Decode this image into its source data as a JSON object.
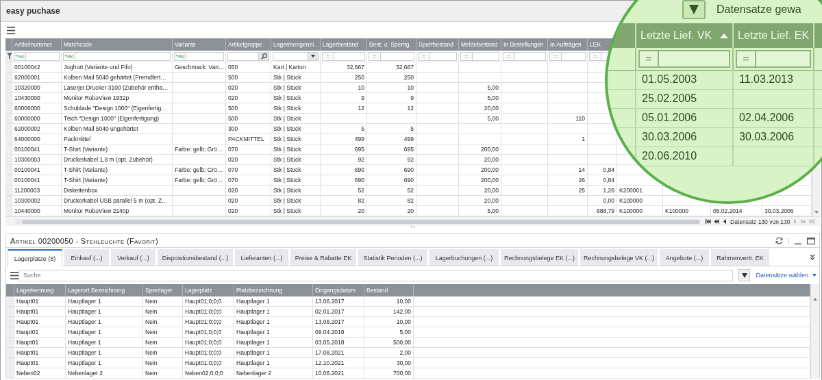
{
  "window": {
    "title": "easy puchase"
  },
  "main_table": {
    "columns": [
      {
        "label": "Artikelnummer",
        "kind": "text"
      },
      {
        "label": "Matchcode",
        "kind": "text"
      },
      {
        "label": "Variante",
        "kind": "text"
      },
      {
        "label": "Artikelgruppe",
        "kind": "text"
      },
      {
        "label": "Lagermengenei…",
        "kind": "text"
      },
      {
        "label": "Lagerbestand",
        "kind": "number"
      },
      {
        "label": "Best. o. Sperrig.",
        "kind": "number"
      },
      {
        "label": "Sperrbestand",
        "kind": "number"
      },
      {
        "label": "Meldebestand",
        "kind": "number"
      },
      {
        "label": "In Bestellungen",
        "kind": "number"
      },
      {
        "label": "In Aufträgen",
        "kind": "number"
      },
      {
        "label": "LEK",
        "kind": "number"
      },
      {
        "kind": "text"
      },
      {
        "kind": "text"
      },
      {
        "kind": "text"
      },
      {
        "kind": "text"
      }
    ],
    "filters": [
      {
        "kind": "pattern",
        "operator": "*%c"
      },
      {
        "kind": "pattern",
        "operator": "*%c"
      },
      {
        "kind": "pattern",
        "operator": "*%c"
      },
      {
        "kind": "search"
      },
      {
        "kind": "dropdown"
      },
      {
        "kind": "equals",
        "operator": "="
      },
      {
        "kind": "equals",
        "operator": "="
      },
      {
        "kind": "equals",
        "operator": "="
      },
      {
        "kind": "equals",
        "operator": "="
      },
      {
        "kind": "equals",
        "operator": "="
      },
      {
        "kind": "equals",
        "operator": "="
      },
      {
        "kind": "equals",
        "operator": "="
      }
    ],
    "rows": [
      [
        "00100042",
        "Joghurt (Variante und Fifo)",
        "Geschmack: Van…",
        "050",
        "Kart  |  Karton",
        "32,667",
        "32,667"
      ],
      [
        "62000001",
        "Kolben Mail 5040 gehärtet (Fremdfert…",
        null,
        "500",
        "Stk  |  Stück",
        "250",
        "250"
      ],
      [
        "10320000",
        "Laserjet Drucker 3100 (Zubehör entha…",
        null,
        "020",
        "Stk  |  Stück",
        "10",
        "10",
        null,
        "5,00"
      ],
      [
        "10430000",
        "Monitor RoboView 1932p",
        null,
        "020",
        "Stk  |  Stück",
        "9",
        "9",
        null,
        "5,00"
      ],
      [
        "60006000",
        "Schublade \"Design 1000\" (Eigenfertig…",
        null,
        "500",
        "Stk  |  Stück",
        "12",
        "12",
        null,
        "20,00"
      ],
      [
        "60000000",
        "Tisch \"Design 1000\" (Eigenfertigung)",
        null,
        "500",
        "Stk  |  Stück",
        null,
        null,
        null,
        "5,00",
        null,
        "110"
      ],
      [
        "62000002",
        "Kolben Mail 5040 ungehärtet",
        null,
        "300",
        "Stk  |  Stück",
        "5",
        "5"
      ],
      [
        "64000000",
        "Packmittel",
        null,
        "PACKMITTEL",
        "Stk  |  Stück",
        "499",
        "499",
        null,
        null,
        null,
        "1"
      ],
      [
        "00100041",
        "T-Shirt (Variante)",
        "Farbe: gelb; Grö…",
        "070",
        "Stk  |  Stück",
        "695",
        "695",
        null,
        "200,00"
      ],
      [
        "10300003",
        "Druckerkabel 1,8 m (opt. Zubehör)",
        null,
        "020",
        "Stk  |  Stück",
        "92",
        "92",
        null,
        "20,00"
      ],
      [
        "00100041",
        "T-Shirt (Variante)",
        "Farbe: gelb; Grö…",
        "070",
        "Stk  |  Stück",
        "690",
        "690",
        null,
        "200,00",
        null,
        "14",
        "0,84"
      ],
      [
        "00100041",
        "T-Shirt (Variante)",
        "Farbe: gelb; Grö…",
        "070",
        "Stk  |  Stück",
        "690",
        "690",
        null,
        "200,00",
        null,
        "26",
        "0,84"
      ],
      [
        "11200003",
        "Diskettenbox",
        null,
        "020",
        "Stk  |  Stück",
        "52",
        "52",
        null,
        "20,00",
        null,
        "25",
        "1,26",
        "K200001"
      ],
      [
        "10300002",
        "Druckerkabel USB parallel 5 m (opt. Z…",
        null,
        "020",
        "Stk  |  Stück",
        "82",
        "82",
        null,
        "20,00",
        null,
        null,
        "0,00",
        "K100000"
      ],
      [
        "10440000",
        "Monitor RoboView 2140p",
        null,
        "020",
        "Stk  |  Stück",
        "20",
        "20",
        null,
        "5,00",
        null,
        null,
        "688,79",
        "K100000",
        "K100000",
        "05.02.2014",
        "30.03.2006"
      ]
    ],
    "pager": {
      "text": "Datensatz 130 von 130",
      "can_go_back": true,
      "can_go_forward": false
    }
  },
  "magnifier": {
    "toolbar_text": "Datensatze gewa",
    "columns": [
      {
        "label": "Letzte Lief. VK",
        "sorted_ascending": true
      },
      {
        "label": "Letzte Lief. EK",
        "sorted_ascending": false
      }
    ],
    "filters": [
      {
        "kind": "equals",
        "operator": "="
      },
      {
        "kind": "equals",
        "operator": "="
      }
    ],
    "rows": [
      [
        "01.05.2003",
        "11.03.2013"
      ],
      [
        "25.02.2005"
      ],
      [
        "05.01.2006",
        "02.04.2006"
      ],
      [
        "30.03.2006",
        "30.03.2006"
      ],
      [
        "20.06.2010"
      ]
    ]
  },
  "detail_panel": {
    "title": "Artikel 00200050 - Stehleuchte  (Favorit)",
    "tabs": [
      {
        "label": "Lagerplätze (8)",
        "selected": true
      },
      {
        "label": "Einkauf (...)",
        "selected": false
      },
      {
        "label": "Verkauf (...)",
        "selected": false
      },
      {
        "label": "Dispositionsbestand (...)",
        "selected": false
      },
      {
        "label": "Lieferanten (...)",
        "selected": false
      },
      {
        "label": "Preise & Rabatte EK",
        "selected": false
      },
      {
        "label": "Statistik Perioden (...)",
        "selected": false
      },
      {
        "label": "Lagerbuchungen (...)",
        "selected": false
      },
      {
        "label": "Rechnungsbelege EK (...)",
        "selected": false
      },
      {
        "label": "Rechnungsbelege VK (...)",
        "selected": false
      },
      {
        "label": "Angebote (...)",
        "selected": false
      },
      {
        "label": "Rahmenvertr. EK",
        "selected": false
      }
    ],
    "search": {
      "placeholder": "Suche"
    },
    "records_link": "Datensätze wählen",
    "table": {
      "columns": [
        {
          "label": "Lagerkennung",
          "kind": "text"
        },
        {
          "label": "Lagerort Bezeichnung",
          "kind": "text"
        },
        {
          "label": "Sperrlager",
          "kind": "text"
        },
        {
          "label": "Lagerplatz",
          "kind": "text"
        },
        {
          "label": "Platzbezeichnung",
          "kind": "text"
        },
        {
          "label": "Eingangsdatum",
          "kind": "text"
        },
        {
          "label": "Bestand",
          "kind": "number"
        }
      ],
      "rows": [
        [
          "Haupt01",
          "Hauptlager 1",
          "Nein",
          "Haupt01;0;0;0",
          "Hauptlager 1",
          "13.06.2017",
          "10,00"
        ],
        [
          "Haupt01",
          "Hauptlager 1",
          "Nein",
          "Haupt01;0;0;0",
          "Hauptlager 1",
          "02.01.2017",
          "142,00"
        ],
        [
          "Haupt01",
          "Hauptlager 1",
          "Nein",
          "Haupt01;0;0;0",
          "Hauptlager 1",
          "13.06.2017",
          "10,00"
        ],
        [
          "Haupt01",
          "Hauptlager 1",
          "Nein",
          "Haupt01;0;0;0",
          "Hauptlager 1",
          "09.04.2018",
          "5,00"
        ],
        [
          "Haupt01",
          "Hauptlager 1",
          "Nein",
          "Haupt01;0;0;0",
          "Hauptlager 1",
          "03.05.2018",
          "500,00"
        ],
        [
          "Haupt01",
          "Hauptlager 1",
          "Nein",
          "Haupt01;0;0;0",
          "Hauptlager 1",
          "17.08.2021",
          "2,00"
        ],
        [
          "Haupt01",
          "Hauptlager 1",
          "Nein",
          "Haupt01;0;0;0",
          "Hauptlager 1",
          "12.10.2021",
          "30,00"
        ],
        [
          "Neben02",
          "Nebenlager 2",
          "Nein",
          "Neben02;0;0;0",
          "Nebenlager 2",
          "10.06.2021",
          "700,00"
        ]
      ]
    }
  }
}
